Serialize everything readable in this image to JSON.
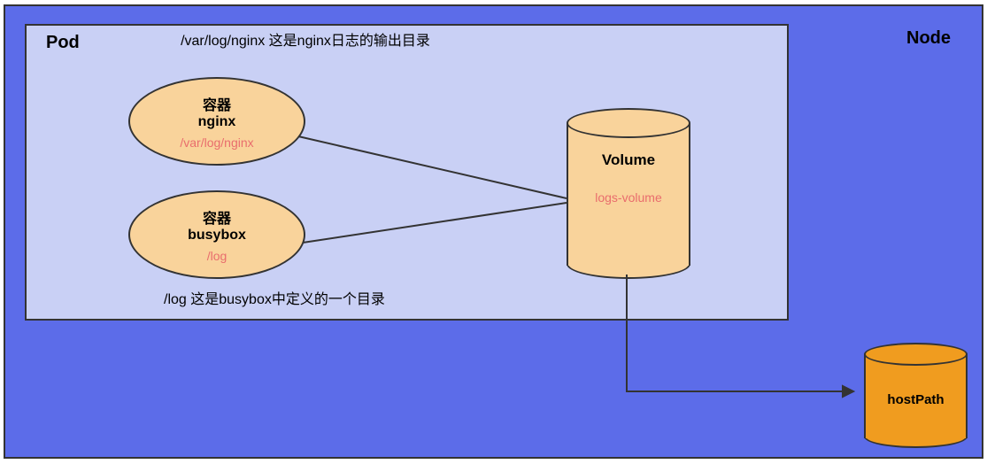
{
  "node": {
    "label": "Node"
  },
  "pod": {
    "label": "Pod",
    "annotations": {
      "nginx_log_path": "/var/log/nginx 这是nginx日志的输出目录",
      "busybox_log_path": "/log 这是busybox中定义的一个目录"
    }
  },
  "containers": {
    "nginx": {
      "title_prefix": "容器",
      "name": "nginx",
      "mount_path": "/var/log/nginx"
    },
    "busybox": {
      "title_prefix": "容器",
      "name": "busybox",
      "mount_path": "/log"
    }
  },
  "volume": {
    "label": "Volume",
    "name": "logs-volume"
  },
  "hostpath": {
    "label": "hostPath"
  },
  "colors": {
    "node_bg": "#5C6CE9",
    "pod_bg": "#C9D0F5",
    "container_fill": "#F9D39B",
    "volume_fill": "#F9D39B",
    "hostpath_fill": "#F09C1F",
    "path_text": "#E96D6D"
  }
}
